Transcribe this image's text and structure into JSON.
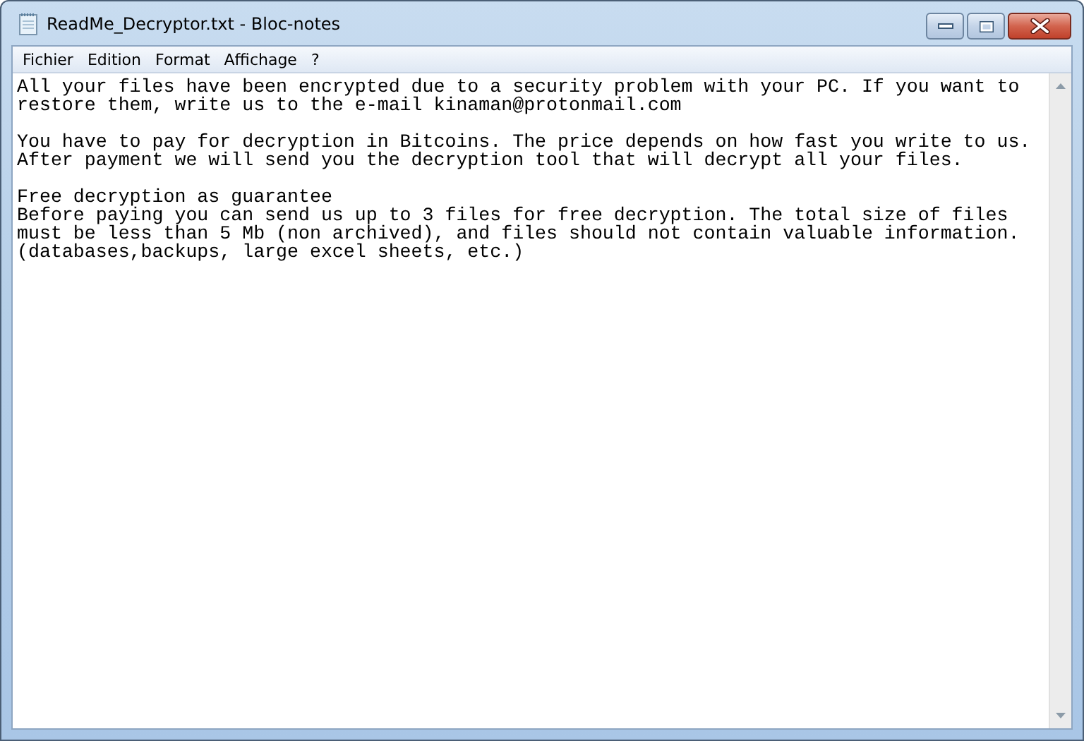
{
  "window": {
    "title": "ReadMe_Decryptor.txt - Bloc-notes"
  },
  "menu": [
    "Fichier",
    "Edition",
    "Format",
    "Affichage",
    "?"
  ],
  "document": {
    "paragraphs": [
      {
        "lines": [
          "All your files have been encrypted due to a security problem with your PC. If you want to",
          "restore them, write us to the e-mail kinaman@protonmail.com"
        ]
      },
      {
        "lines": [
          "You have to pay for decryption in Bitcoins. The price depends on how fast you write to us.",
          "After payment we will send you the decryption tool that will decrypt all your files."
        ]
      },
      {
        "lines": [
          "Free decryption as guarantee",
          "Before paying you can send us up to 3 files for free decryption. The total size of files",
          "must be less than 5 Mb (non archived), and files should not contain valuable information.",
          "(databases,backups, large excel sheets, etc.)"
        ]
      }
    ]
  }
}
